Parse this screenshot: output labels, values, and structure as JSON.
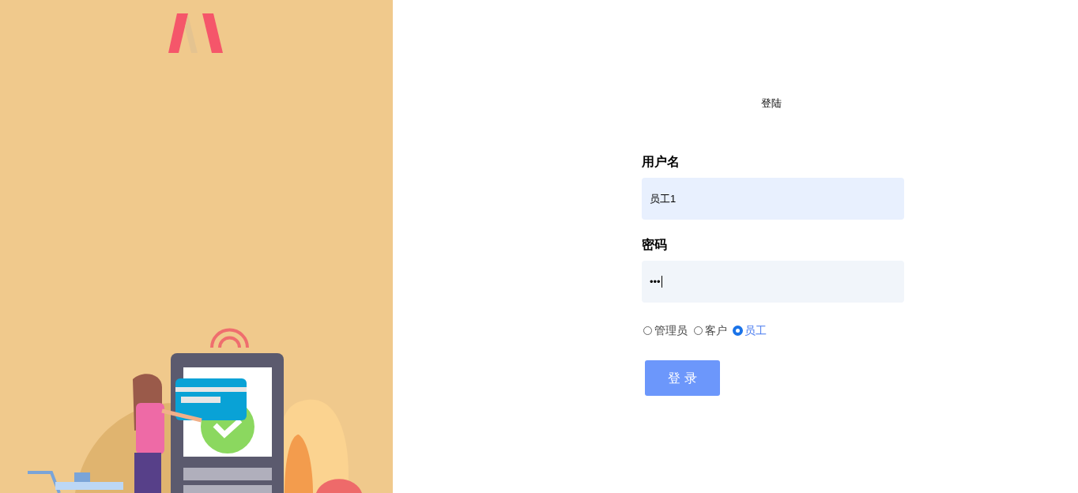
{
  "title": "登陆",
  "fields": [
    {
      "label": "用户名",
      "value": "员工1",
      "focused": false
    },
    {
      "label": "密码",
      "value": "•••",
      "focused": true
    }
  ],
  "roles": [
    {
      "label": "管理员",
      "selected": false
    },
    {
      "label": "客户",
      "selected": false
    },
    {
      "label": "员工",
      "selected": true
    }
  ],
  "submit": "登 录"
}
